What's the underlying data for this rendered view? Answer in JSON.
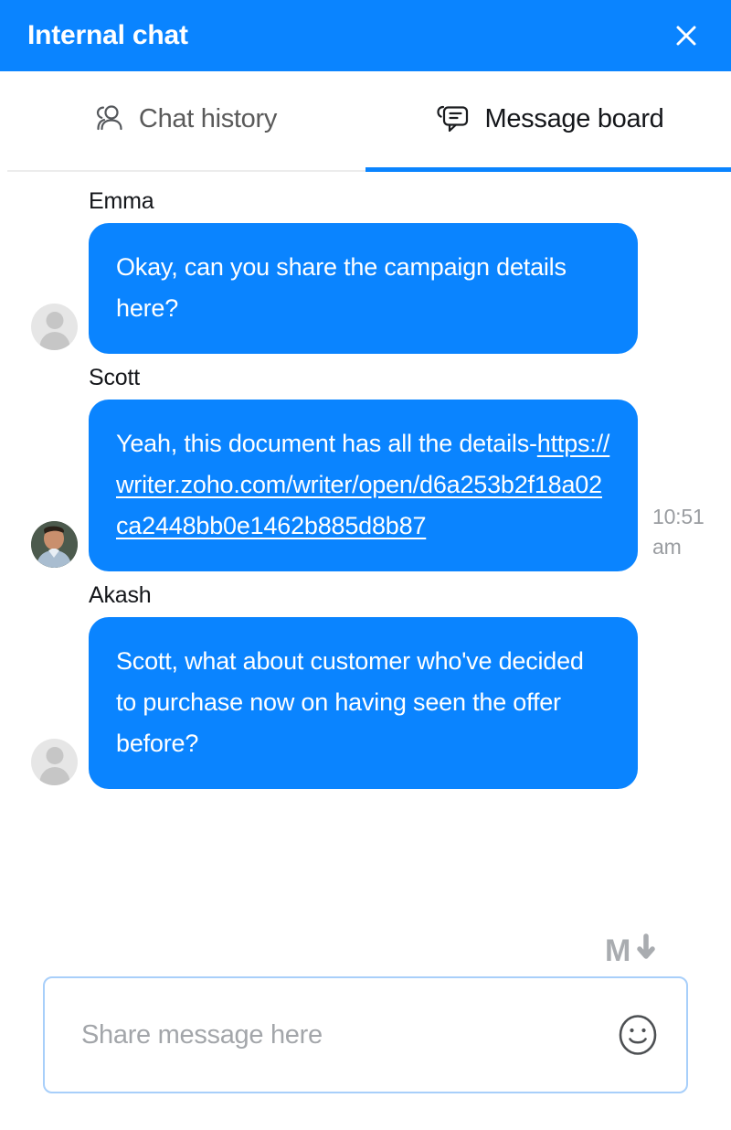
{
  "window": {
    "title": "Internal chat",
    "close_icon": "close-icon",
    "header_color": "#0A84FF"
  },
  "tabs": [
    {
      "label": "Chat history",
      "icon": "people-icon",
      "active": false
    },
    {
      "label": "Message board",
      "icon": "chat-bubble-icon",
      "active": true
    }
  ],
  "messages": [
    {
      "sender": "Emma",
      "avatar": "default-avatar",
      "text": "Okay, can you share the campaign details here?",
      "time": ""
    },
    {
      "sender": "Scott",
      "avatar": "photo-avatar",
      "text_prefix": "Yeah, this document has all the details-",
      "link": "https://writer.zoho.com/writer/open/d6a253b2f18a02ca2448bb0e1462b885d8b87",
      "time_hour": "10:51",
      "time_meridiem": "am"
    },
    {
      "sender": "Akash",
      "avatar": "default-avatar",
      "text": "Scott, what about customer who've decided to purchase now on having seen the offer before?",
      "time": ""
    }
  ],
  "markdown_hint": {
    "icon": "markdown-icon",
    "label": "M"
  },
  "composer": {
    "placeholder": "Share message here",
    "value": "",
    "emoji_icon": "smiley-icon",
    "border_color": "#a8cffa"
  },
  "colors": {
    "accent": "#0A84FF",
    "bubble": "#0A84FF",
    "text_dark": "#14161a",
    "text_muted": "#9a9da1"
  }
}
